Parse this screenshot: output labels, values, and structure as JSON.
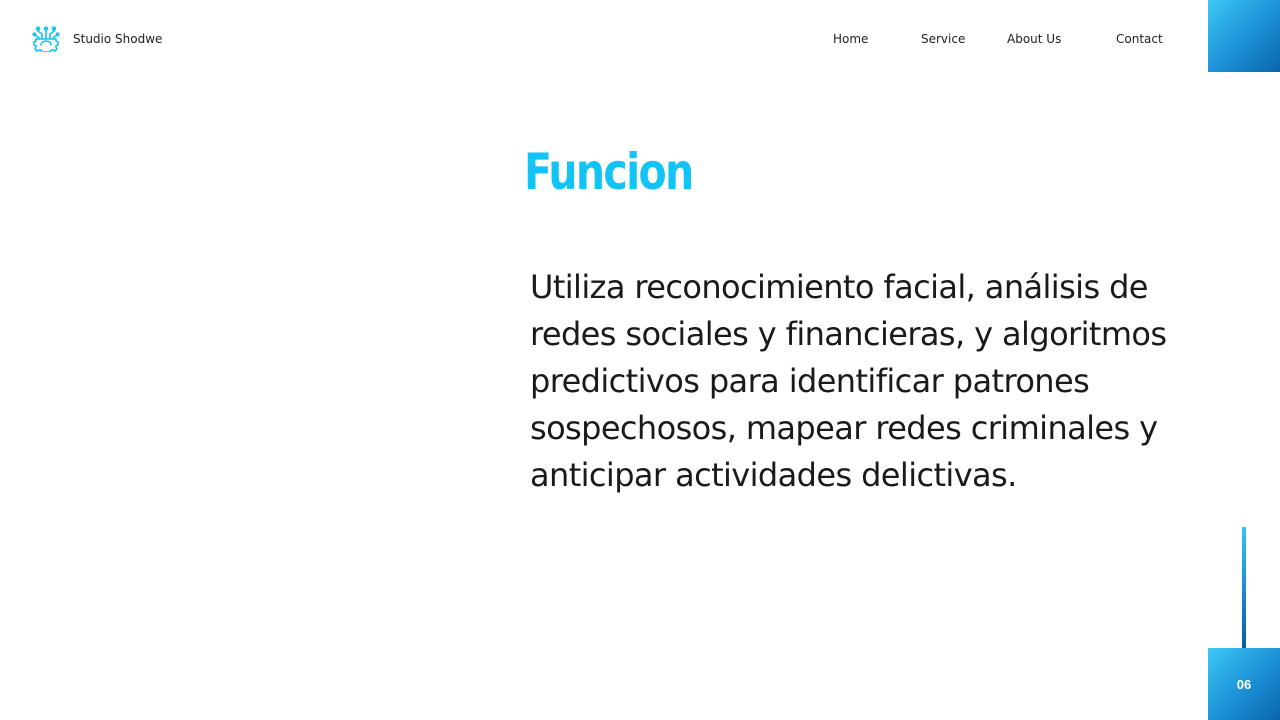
{
  "brand": {
    "name": "Studio Shodwe",
    "icon": "gear-circuit-logo-icon",
    "color": "#12c3f6"
  },
  "nav": {
    "items": [
      {
        "label": "Home"
      },
      {
        "label": "Service"
      },
      {
        "label": "About Us"
      },
      {
        "label": "Contact"
      }
    ]
  },
  "main": {
    "title": "Funcion",
    "body": "Utiliza reconocimiento facial, análisis de redes sociales y financieras, y algoritmos predictivos para identificar patrones sospechosos, mapear redes criminales y anticipar actividades delictivas."
  },
  "footer": {
    "page_number": "06"
  },
  "colors": {
    "accent": "#12c3f6",
    "gradient_start": "#3ec9f5",
    "gradient_end": "#0b65ad",
    "text": "#1a1a1a",
    "background": "#ffffff"
  }
}
